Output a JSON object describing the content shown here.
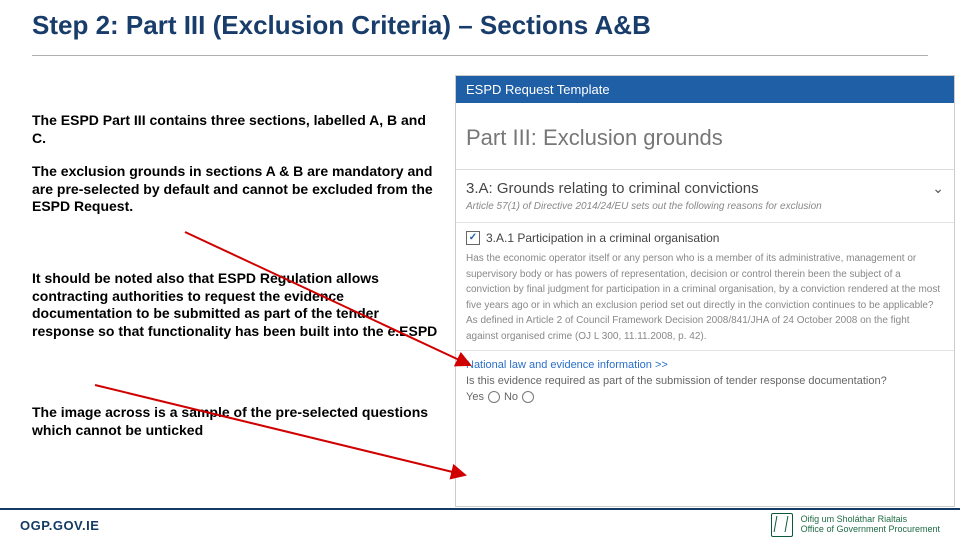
{
  "title": "Step 2: Part III (Exclusion Criteria) – Sections A&B",
  "left": {
    "p1": "The ESPD Part III contains three sections, labelled A, B and C.",
    "p2": "The exclusion grounds in sections A & B are mandatory and are pre-selected by default and cannot be excluded from the ESPD Request.",
    "p3": "It should be noted also that ESPD Regulation allows contracting authorities to request the evidence documentation to be submitted as part of the tender response so that functionality has been built into the e.ESPD",
    "p4": "The image across is a sample of the pre-selected questions which cannot be unticked"
  },
  "shot": {
    "bar": "ESPD Request Template",
    "part_title": "Part III: Exclusion grounds",
    "sec_a": {
      "heading": "3.A: Grounds relating to criminal convictions",
      "article": "Article 57(1) of Directive 2014/24/EU sets out the following reasons for exclusion"
    },
    "sub": {
      "check": "✓",
      "heading": "3.A.1 Participation in a criminal organisation",
      "body": "Has the economic operator itself or any person who is a member of its administrative, management or supervisory body or has powers of representation, decision or control therein been the subject of a conviction by final judgment for participation in a criminal organisation, by a conviction rendered at the most five years ago or in which an exclusion period set out directly in the conviction continues to be applicable? As defined in Article 2 of Council Framework Decision 2008/841/JHA of 24 October 2008 on the fight against organised crime (OJ L 300, 11.11.2008, p. 42)."
    },
    "evidence": {
      "link": "National law and evidence information >>",
      "question": "Is this evidence required as part of the submission of tender response documentation?",
      "yes": "Yes",
      "no": "No"
    }
  },
  "footer": {
    "url": "OGP.GOV.IE",
    "logo_line1": "Oifig um Sholáthar Rialtais",
    "logo_line2": "Office of Government Procurement"
  }
}
